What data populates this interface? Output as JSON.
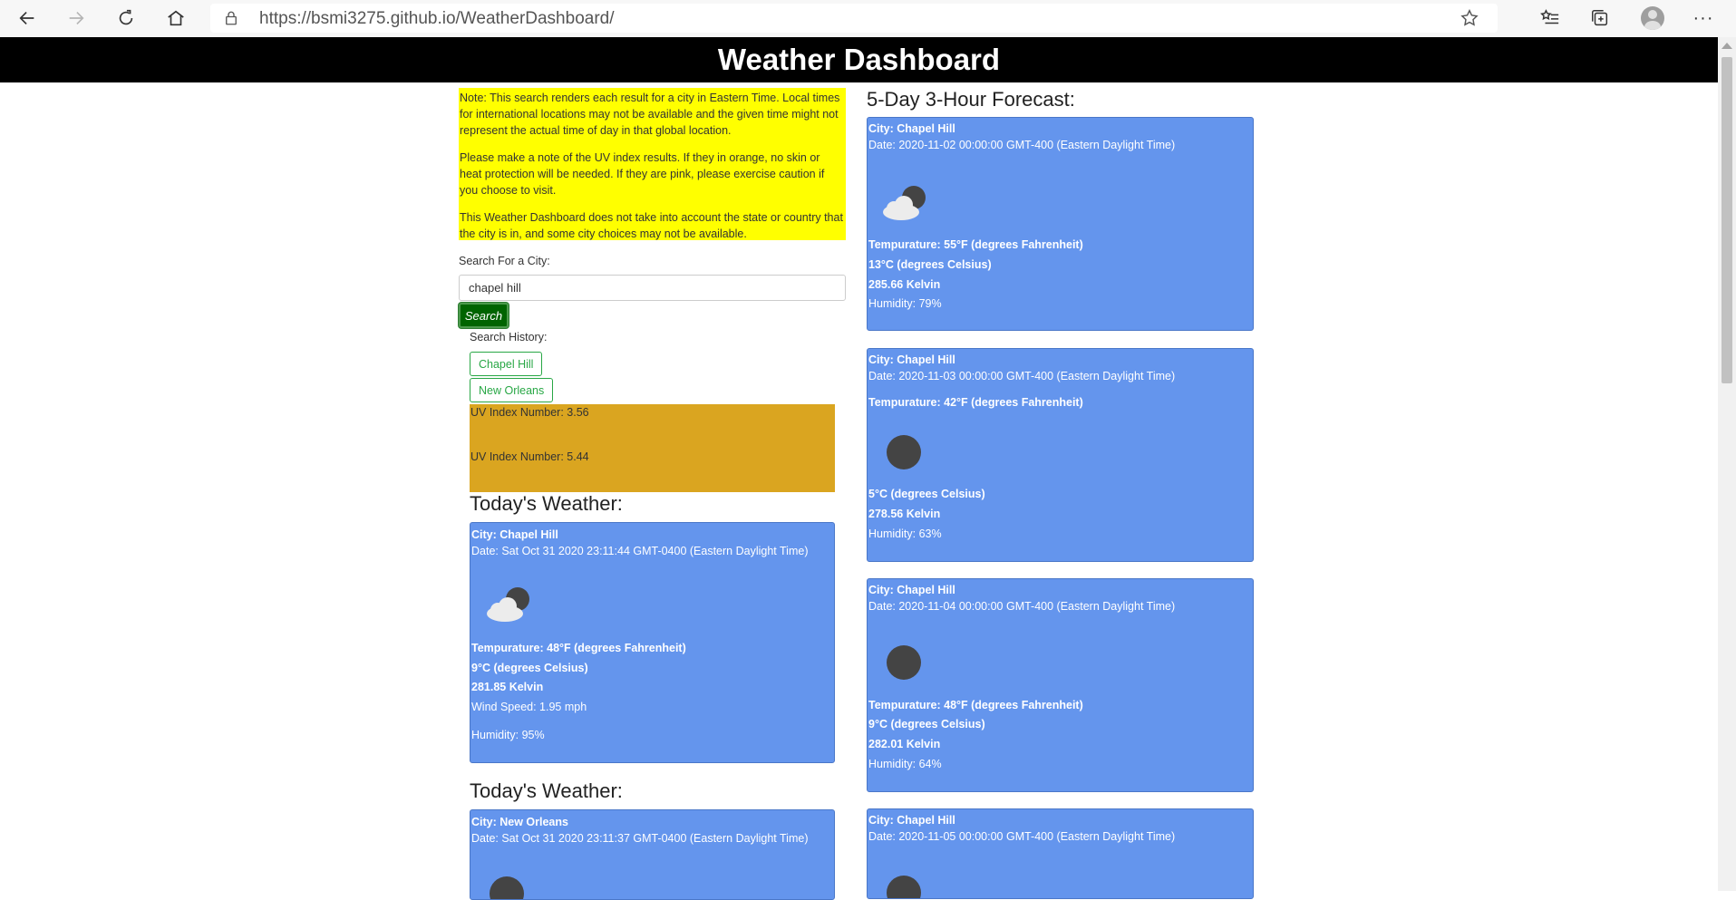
{
  "browser": {
    "url": "https://bsmi3275.github.io/WeatherDashboard/"
  },
  "page": {
    "title": "Weather Dashboard",
    "note_paragraphs": [
      "Note: This search renders each result for a city in Eastern Time. Local times for international locations may not be available and the given time might not represent the actual time of day in that global location.",
      "Please make a note of the UV index results. If they in orange, no skin or heat protection will be needed. If they are pink, please exercise caution if you choose to visit.",
      "This Weather Dashboard does not take into account the state or country that the city is in, and some city choices may not be available."
    ],
    "search_label": "Search For a City:",
    "search_value": "chapel hill",
    "search_button": "Search",
    "history_label": "Search History:",
    "history": [
      "Chapel Hill",
      "New Orleans"
    ],
    "uv": [
      "UV Index Number: 3.56",
      "UV Index Number: 5.44"
    ],
    "uv_color": "#daa520",
    "note_color": "#ffff00",
    "card_color": "#6495ed"
  },
  "today": [
    {
      "title": "Today's Weather:",
      "city": "City: Chapel Hill",
      "date": "Date: Sat Oct 31 2020 23:11:44 GMT-0400 (Eastern Daylight Time)",
      "icon": "partly-cloudy-night-icon",
      "temp_f": "Tempurature: 48°F (degrees Fahrenheit)",
      "temp_c": "9°C (degrees Celsius)",
      "temp_k": "281.85 Kelvin",
      "wind": "Wind Speed: 1.95 mph",
      "humidity": "Humidity: 95%"
    },
    {
      "title": "Today's Weather:",
      "city": "City: New Orleans",
      "date": "Date: Sat Oct 31 2020 23:11:37 GMT-0400 (Eastern Daylight Time)",
      "icon": "moon-icon"
    }
  ],
  "forecast": {
    "title": "5-Day 3-Hour Forecast:",
    "cards": [
      {
        "city": "City: Chapel Hill",
        "date": "Date: 2020-11-02 00:00:00 GMT-400 (Eastern Daylight Time)",
        "icon": "partly-cloudy-night-icon",
        "temp_f": "Tempurature: 55°F (degrees Fahrenheit)",
        "temp_c": "13°C (degrees Celsius)",
        "temp_k": "285.66 Kelvin",
        "humidity": "Humidity: 79%"
      },
      {
        "city": "City: Chapel Hill",
        "date": "Date: 2020-11-03 00:00:00 GMT-400 (Eastern Daylight Time)",
        "temp_f": "Tempurature: 42°F (degrees Fahrenheit)",
        "icon": "moon-icon",
        "temp_c": "5°C (degrees Celsius)",
        "temp_k": "278.56 Kelvin",
        "humidity": "Humidity: 63%"
      },
      {
        "city": "City: Chapel Hill",
        "date": "Date: 2020-11-04 00:00:00 GMT-400 (Eastern Daylight Time)",
        "icon": "moon-icon",
        "temp_f": "Tempurature: 48°F (degrees Fahrenheit)",
        "temp_c": "9°C (degrees Celsius)",
        "temp_k": "282.01 Kelvin",
        "humidity": "Humidity: 64%"
      },
      {
        "city": "City: Chapel Hill",
        "date": "Date: 2020-11-05 00:00:00 GMT-400 (Eastern Daylight Time)",
        "icon": "moon-icon"
      }
    ]
  }
}
